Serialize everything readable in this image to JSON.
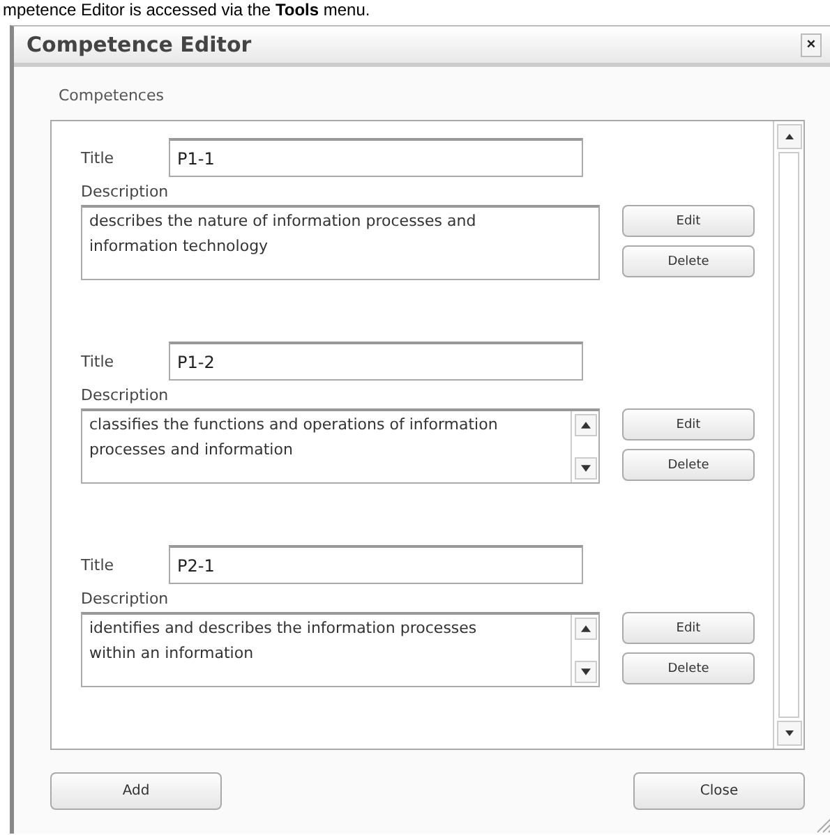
{
  "caption": "mpetence Editor is accessed via the **Tools** menu.",
  "window": {
    "title": "Competence Editor",
    "close": "×"
  },
  "section_label": "Competences",
  "competences": [
    {
      "title_label": "Title",
      "title": "P1-1",
      "description_label": "Description",
      "description": "describes the nature of information processes and information technology",
      "scrollbar": false,
      "edit": "Edit",
      "delete": "Delete"
    },
    {
      "title_label": "Title",
      "title": "P1-2",
      "description_label": "Description",
      "description": "classifies the functions and operations of information processes and information",
      "scrollbar": true,
      "edit": "Edit",
      "delete": "Delete"
    },
    {
      "title_label": "Title",
      "title": "P2-1",
      "description_label": "Description",
      "description": "identifies and describes the information processes within an information",
      "scrollbar": true,
      "edit": "Edit",
      "delete": "Delete"
    }
  ],
  "buttons": {
    "add": "Add",
    "close": "Close"
  }
}
